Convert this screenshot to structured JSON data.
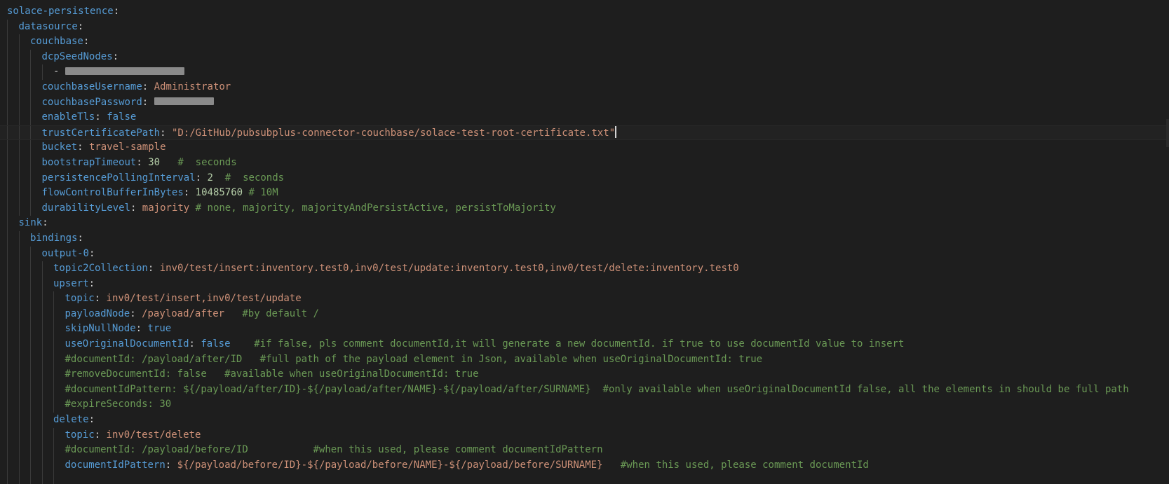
{
  "editor": {
    "language": "yaml",
    "theme_colors": {
      "background": "#1e1e1e",
      "key": "#569cd6",
      "string": "#ce9178",
      "number": "#b5cea8",
      "comment": "#6a9955",
      "punct": "#d4d4d4"
    },
    "lines": [
      {
        "indent": 0,
        "tokens": [
          {
            "t": "k",
            "v": "solace-persistence"
          },
          {
            "t": "p",
            "v": ":"
          }
        ]
      },
      {
        "indent": 1,
        "tokens": [
          {
            "t": "k",
            "v": "datasource"
          },
          {
            "t": "p",
            "v": ":"
          }
        ]
      },
      {
        "indent": 2,
        "tokens": [
          {
            "t": "k",
            "v": "couchbase"
          },
          {
            "t": "p",
            "v": ":"
          }
        ]
      },
      {
        "indent": 3,
        "tokens": [
          {
            "t": "k",
            "v": "dcpSeedNodes"
          },
          {
            "t": "p",
            "v": ":"
          }
        ]
      },
      {
        "indent": 4,
        "tokens": [
          {
            "t": "p",
            "v": "- "
          },
          {
            "t": "redact",
            "v": "",
            "w": 170
          }
        ]
      },
      {
        "indent": 3,
        "tokens": [
          {
            "t": "k",
            "v": "couchbaseUsername"
          },
          {
            "t": "p",
            "v": ": "
          },
          {
            "t": "s",
            "v": "Administrator"
          }
        ]
      },
      {
        "indent": 3,
        "tokens": [
          {
            "t": "k",
            "v": "couchbasePassword"
          },
          {
            "t": "p",
            "v": ": "
          },
          {
            "t": "redact",
            "v": "",
            "w": 85
          }
        ]
      },
      {
        "indent": 3,
        "tokens": [
          {
            "t": "k",
            "v": "enableTls"
          },
          {
            "t": "p",
            "v": ": "
          },
          {
            "t": "b",
            "v": "false"
          }
        ]
      },
      {
        "indent": 3,
        "current": true,
        "tokens": [
          {
            "t": "k",
            "v": "trustCertificatePath"
          },
          {
            "t": "p",
            "v": ": "
          },
          {
            "t": "s",
            "v": "\"D:/GitHub/pubsubplus-connector-couchbase/solace-test-root-certificate.txt\""
          },
          {
            "t": "cursor",
            "v": ""
          }
        ]
      },
      {
        "indent": 3,
        "tokens": [
          {
            "t": "k",
            "v": "bucket"
          },
          {
            "t": "p",
            "v": ": "
          },
          {
            "t": "s",
            "v": "travel-sample"
          }
        ]
      },
      {
        "indent": 3,
        "tokens": [
          {
            "t": "k",
            "v": "bootstrapTimeout"
          },
          {
            "t": "p",
            "v": ": "
          },
          {
            "t": "n",
            "v": "30"
          },
          {
            "t": "c",
            "v": "   #  seconds"
          }
        ]
      },
      {
        "indent": 3,
        "tokens": [
          {
            "t": "k",
            "v": "persistencePollingInterval"
          },
          {
            "t": "p",
            "v": ": "
          },
          {
            "t": "n",
            "v": "2"
          },
          {
            "t": "c",
            "v": "  #  seconds"
          }
        ]
      },
      {
        "indent": 3,
        "tokens": [
          {
            "t": "k",
            "v": "flowControlBufferInBytes"
          },
          {
            "t": "p",
            "v": ": "
          },
          {
            "t": "n",
            "v": "10485760"
          },
          {
            "t": "c",
            "v": " # 10M"
          }
        ]
      },
      {
        "indent": 3,
        "tokens": [
          {
            "t": "k",
            "v": "durabilityLevel"
          },
          {
            "t": "p",
            "v": ": "
          },
          {
            "t": "s",
            "v": "majority"
          },
          {
            "t": "c",
            "v": " # none, majority, majorityAndPersistActive, persistToMajority"
          }
        ]
      },
      {
        "indent": 1,
        "tokens": [
          {
            "t": "k",
            "v": "sink"
          },
          {
            "t": "p",
            "v": ":"
          }
        ]
      },
      {
        "indent": 2,
        "tokens": [
          {
            "t": "k",
            "v": "bindings"
          },
          {
            "t": "p",
            "v": ":"
          }
        ]
      },
      {
        "indent": 3,
        "tokens": [
          {
            "t": "k",
            "v": "output-0"
          },
          {
            "t": "p",
            "v": ":"
          }
        ]
      },
      {
        "indent": 4,
        "tokens": [
          {
            "t": "k",
            "v": "topic2Collection"
          },
          {
            "t": "p",
            "v": ": "
          },
          {
            "t": "s",
            "v": "inv0/test/insert:inventory.test0,inv0/test/update:inventory.test0,inv0/test/delete:inventory.test0"
          }
        ]
      },
      {
        "indent": 4,
        "tokens": [
          {
            "t": "k",
            "v": "upsert"
          },
          {
            "t": "p",
            "v": ":"
          }
        ]
      },
      {
        "indent": 5,
        "tokens": [
          {
            "t": "k",
            "v": "topic"
          },
          {
            "t": "p",
            "v": ": "
          },
          {
            "t": "s",
            "v": "inv0/test/insert,inv0/test/update"
          }
        ]
      },
      {
        "indent": 5,
        "tokens": [
          {
            "t": "k",
            "v": "payloadNode"
          },
          {
            "t": "p",
            "v": ": "
          },
          {
            "t": "s",
            "v": "/payload/after"
          },
          {
            "t": "c",
            "v": "   #by default /"
          }
        ]
      },
      {
        "indent": 5,
        "tokens": [
          {
            "t": "k",
            "v": "skipNullNode"
          },
          {
            "t": "p",
            "v": ": "
          },
          {
            "t": "b",
            "v": "true"
          }
        ]
      },
      {
        "indent": 5,
        "tokens": [
          {
            "t": "k",
            "v": "useOriginalDocumentId"
          },
          {
            "t": "p",
            "v": ": "
          },
          {
            "t": "b",
            "v": "false"
          },
          {
            "t": "c",
            "v": "    #if false, pls comment documentId,it will generate a new documentId. if true to use documentId value to insert"
          }
        ]
      },
      {
        "indent": 5,
        "tokens": [
          {
            "t": "c",
            "v": "#documentId: /payload/after/ID   #full path of the payload element in Json, available when useOriginalDocumentId: true"
          }
        ]
      },
      {
        "indent": 5,
        "tokens": [
          {
            "t": "c",
            "v": "#removeDocumentId: false   #available when useOriginalDocumentId: true"
          }
        ]
      },
      {
        "indent": 5,
        "tokens": [
          {
            "t": "c",
            "v": "#documentIdPattern: ${/payload/after/ID}-${/payload/after/NAME}-${/payload/after/SURNAME}  #only available when useOriginalDocumentId false, all the elements in should be full path"
          }
        ]
      },
      {
        "indent": 5,
        "tokens": [
          {
            "t": "c",
            "v": "#expireSeconds: 30"
          }
        ]
      },
      {
        "indent": 4,
        "tokens": [
          {
            "t": "k",
            "v": "delete"
          },
          {
            "t": "p",
            "v": ":"
          }
        ]
      },
      {
        "indent": 5,
        "tokens": [
          {
            "t": "k",
            "v": "topic"
          },
          {
            "t": "p",
            "v": ": "
          },
          {
            "t": "s",
            "v": "inv0/test/delete"
          }
        ]
      },
      {
        "indent": 5,
        "tokens": [
          {
            "t": "c",
            "v": "#documentId: /payload/before/ID           #when this used, please comment documentIdPattern"
          }
        ]
      },
      {
        "indent": 5,
        "tokens": [
          {
            "t": "k",
            "v": "documentIdPattern"
          },
          {
            "t": "p",
            "v": ": "
          },
          {
            "t": "s",
            "v": "${/payload/before/ID}-${/payload/before/NAME}-${/payload/before/SURNAME}"
          },
          {
            "t": "c",
            "v": "   #when this used, please comment documentId"
          }
        ]
      },
      {
        "indent": 5,
        "tokens": []
      }
    ]
  }
}
